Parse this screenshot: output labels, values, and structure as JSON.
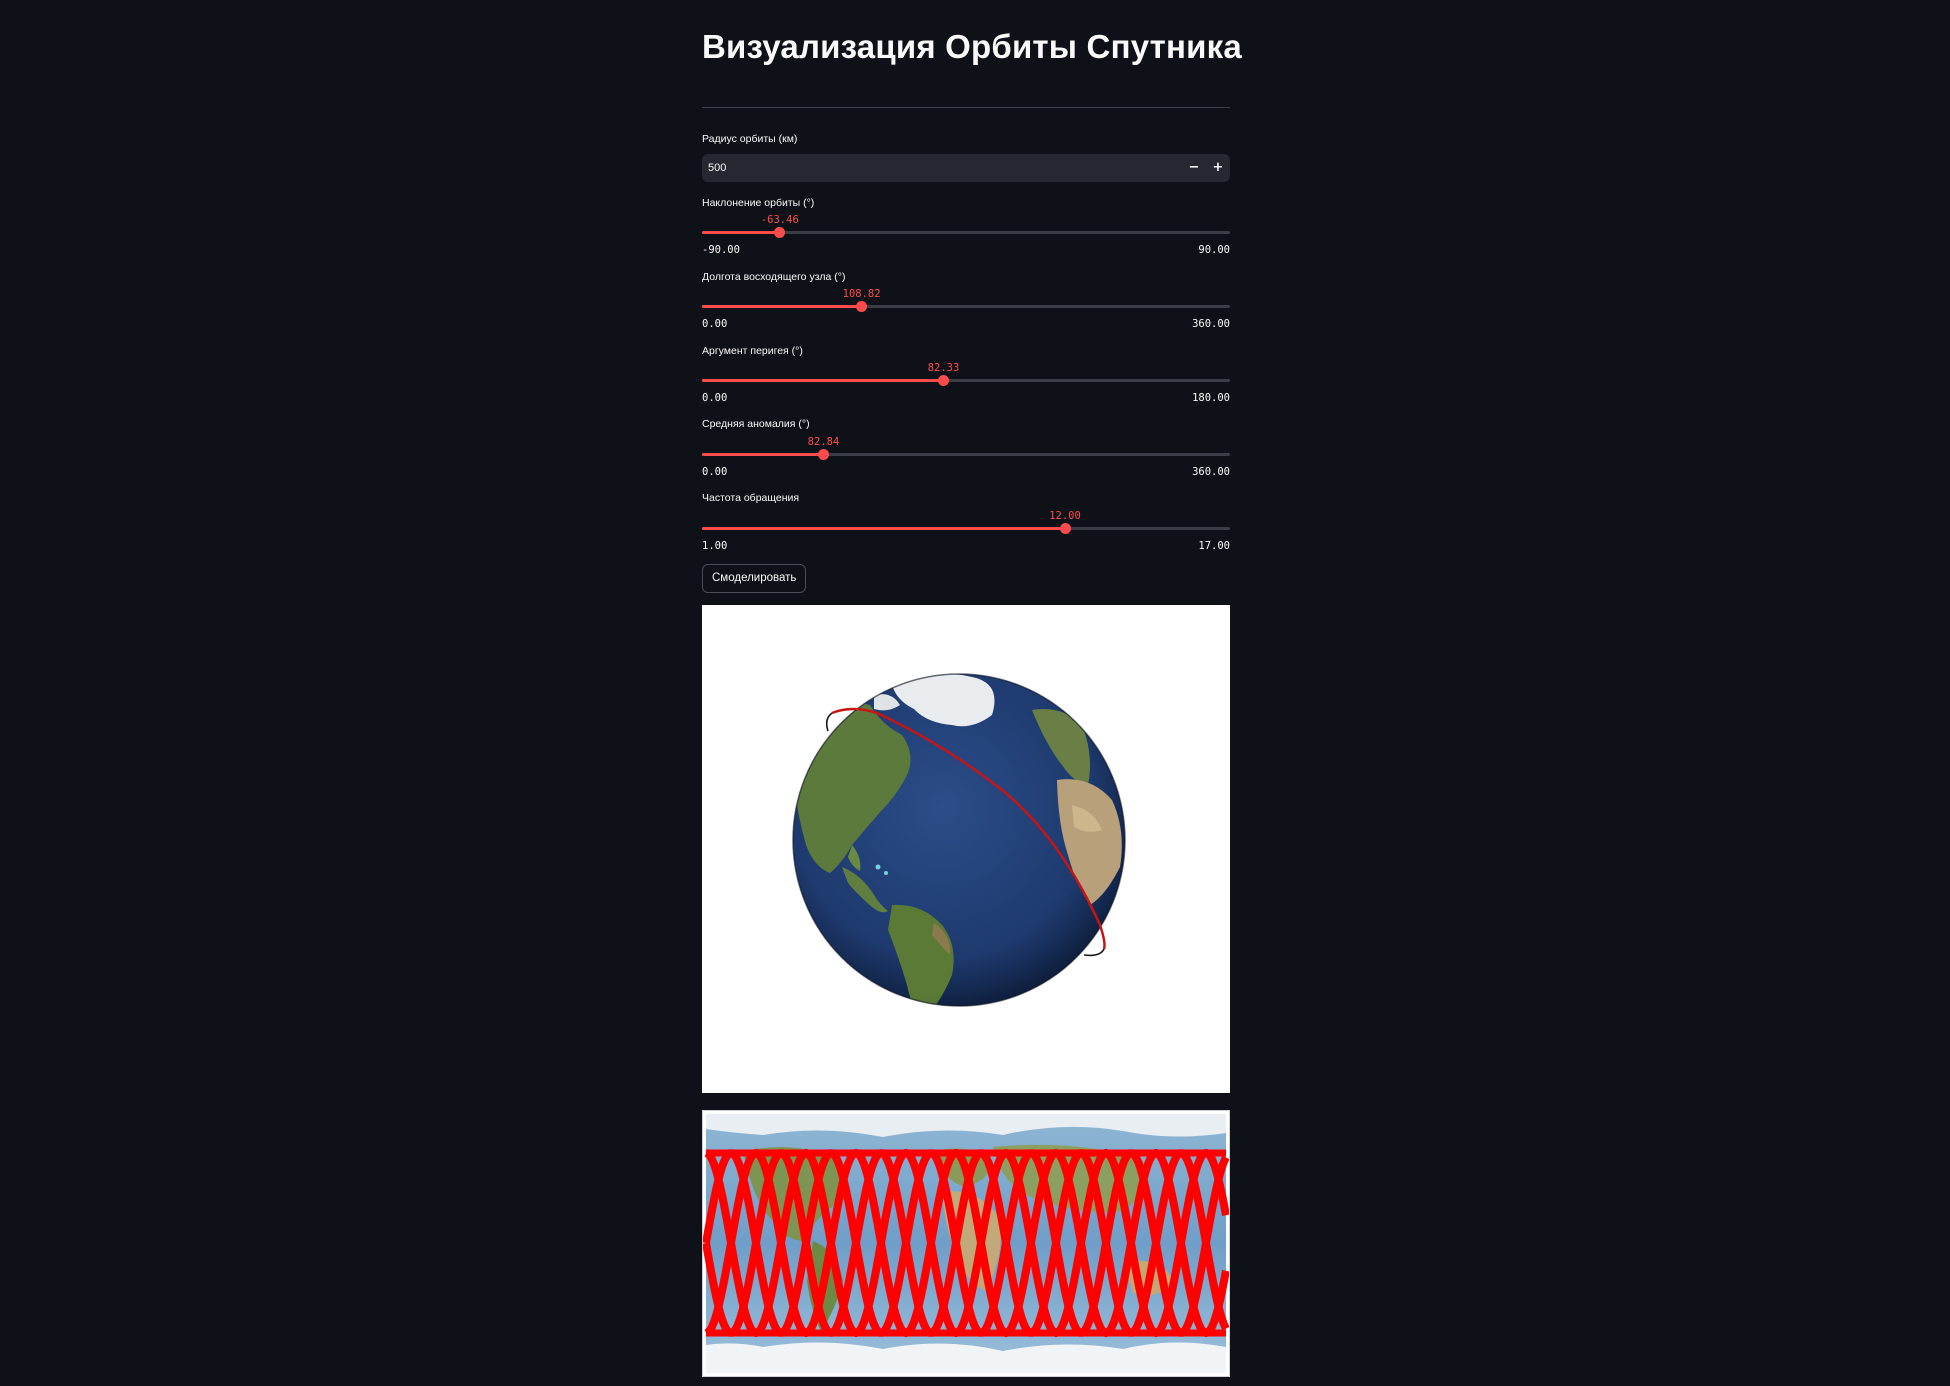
{
  "page": {
    "title": "Визуализация Орбиты Спутника"
  },
  "radius": {
    "label": "Радиус орбиты (км)",
    "value": "500",
    "minus": "−",
    "plus": "+"
  },
  "sliders": [
    {
      "label": "Наклонение орбиты (°)",
      "value": "-63.46",
      "min": "-90.00",
      "max": "90.00",
      "fraction": 0.1474
    },
    {
      "label": "Долгота восходящего узла (°)",
      "value": "108.82",
      "min": "0.00",
      "max": "360.00",
      "fraction": 0.3023
    },
    {
      "label": "Аргумент перигея (°)",
      "value": "82.33",
      "min": "0.00",
      "max": "180.00",
      "fraction": 0.4574
    },
    {
      "label": "Средняя аномалия (°)",
      "value": "82.84",
      "min": "0.00",
      "max": "360.00",
      "fraction": 0.2301
    },
    {
      "label": "Частота обращения",
      "value": "12.00",
      "min": "1.00",
      "max": "17.00",
      "fraction": 0.6875
    }
  ],
  "simulate_button": "Смоделировать",
  "colors": {
    "accent": "#ff4b4b",
    "background": "#0e1117",
    "input_bg": "#262730",
    "orbit": "#ff0000"
  },
  "plots": {
    "globe": "earth-globe-3d-with-orbit",
    "map": "ground-track-equirectangular-map"
  }
}
